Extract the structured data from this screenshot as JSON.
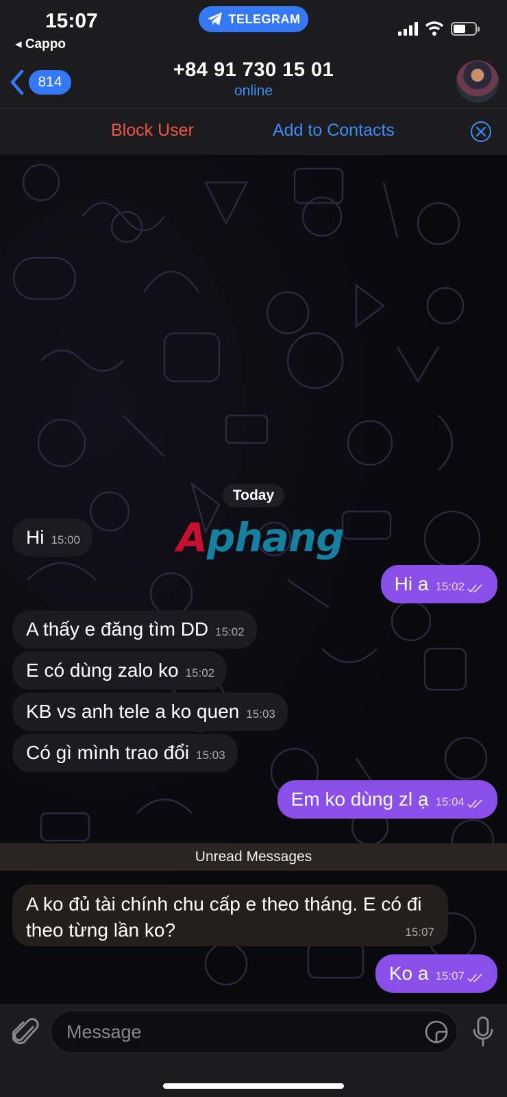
{
  "status_bar": {
    "time": "15:07",
    "back_app": "◂ Cappo",
    "pill_label": "TELEGRAM",
    "icons": [
      "signal-icon",
      "wifi-icon",
      "battery-icon"
    ]
  },
  "nav": {
    "back_count": "814",
    "contact_name": "+84 91 730 15 01",
    "contact_status": "online"
  },
  "actions": {
    "block_label": "Block User",
    "add_label": "Add to Contacts"
  },
  "chat": {
    "date_label": "Today",
    "watermark_a": "A",
    "watermark_b": "phang",
    "unread_label": "Unread Messages",
    "messages": [
      {
        "dir": "in",
        "text": "Hi",
        "time": "15:00"
      },
      {
        "dir": "out",
        "text": "Hi a",
        "time": "15:02"
      },
      {
        "dir": "in",
        "text": "A thấy e đăng tìm DD",
        "time": "15:02"
      },
      {
        "dir": "in",
        "text": "E có dùng zalo ko",
        "time": "15:02"
      },
      {
        "dir": "in",
        "text": "KB vs anh tele a ko quen",
        "time": "15:03"
      },
      {
        "dir": "in",
        "text": "Có gì mình trao đổi",
        "time": "15:03"
      },
      {
        "dir": "out",
        "text": "Em ko dùng zl ạ",
        "time": "15:04"
      },
      {
        "dir": "in",
        "text": "A ko đủ tài chính chu cấp e theo tháng. E có đi theo từng lần ko?",
        "time": "15:07"
      },
      {
        "dir": "out",
        "text": "Ko a",
        "time": "15:07"
      }
    ]
  },
  "input": {
    "placeholder": "Message"
  },
  "colors": {
    "accent": "#3478f6",
    "outgoing_bubble": "#8a4fe8",
    "danger": "#ec5548"
  }
}
